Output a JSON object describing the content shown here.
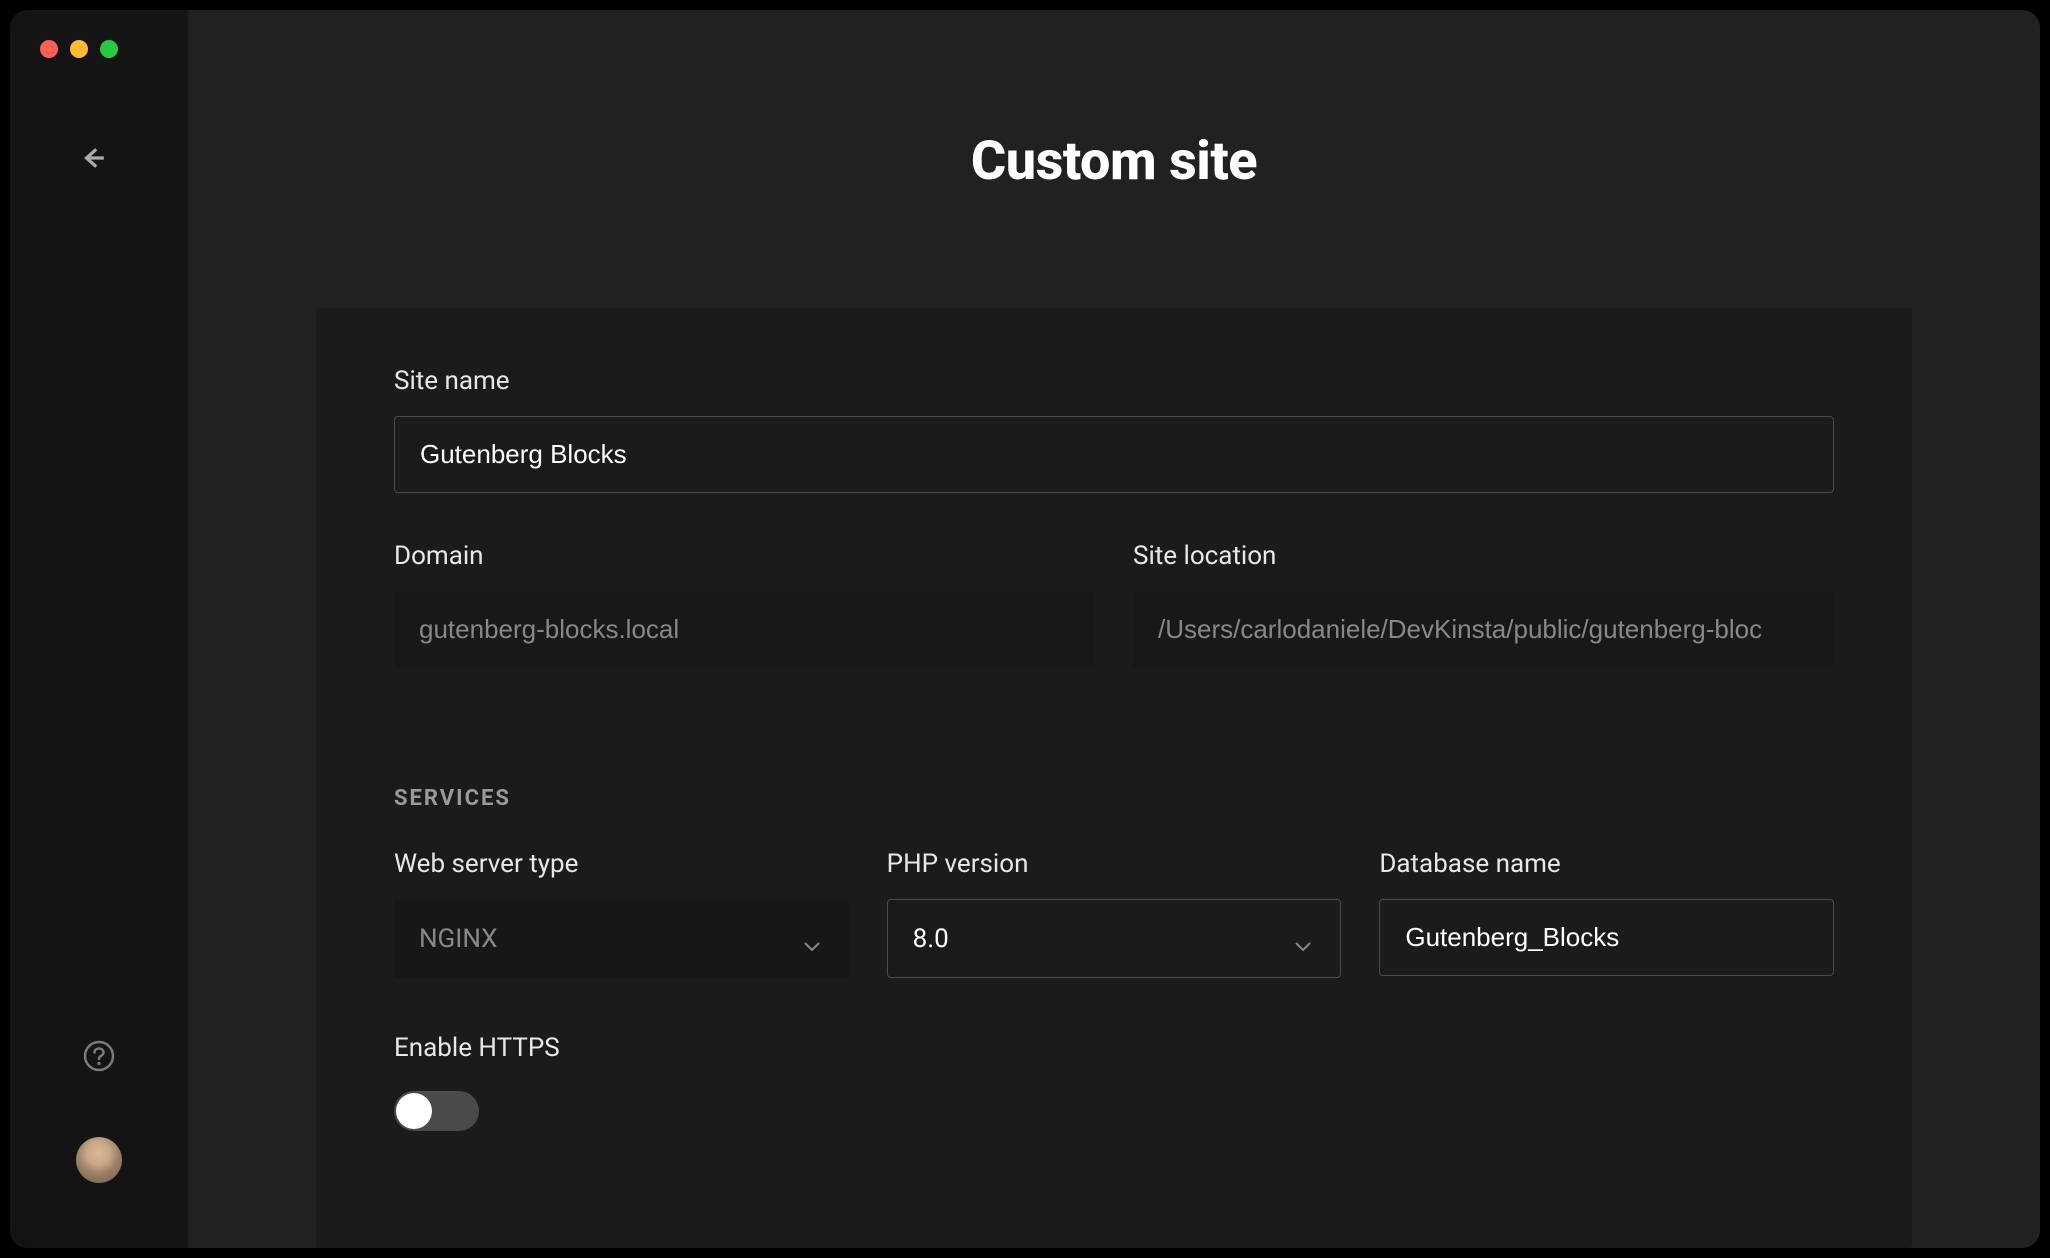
{
  "page": {
    "title": "Custom site"
  },
  "form": {
    "site_name_label": "Site name",
    "site_name_value": "Gutenberg Blocks",
    "domain_label": "Domain",
    "domain_value": "gutenberg-blocks.local",
    "site_location_label": "Site location",
    "site_location_value": "/Users/carlodaniele/DevKinsta/public/gutenberg-bloc"
  },
  "services": {
    "heading": "SERVICES",
    "web_server_label": "Web server type",
    "web_server_value": "NGINX",
    "php_version_label": "PHP version",
    "php_version_value": "8.0",
    "database_name_label": "Database name",
    "database_name_value": "Gutenberg_Blocks",
    "enable_https_label": "Enable HTTPS",
    "enable_https_value": false
  }
}
